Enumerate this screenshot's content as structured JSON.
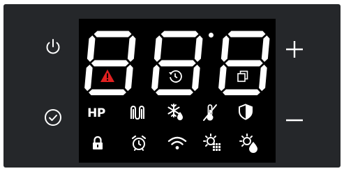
{
  "panel": {
    "power_icon": "power-icon",
    "ok_icon": "check-circle-icon",
    "plus_icon": "plus-icon",
    "minus_icon": "minus-icon"
  },
  "display": {
    "digits": [
      "8",
      "8",
      "8"
    ],
    "segment_color": "#ffffff",
    "alarm_color": "#e02020"
  },
  "icons_row1": {
    "hp_label": "HP",
    "heater_icon": "heater-icon",
    "defrost_icon": "defrost-icon",
    "temperature_off_icon": "temperature-off-icon",
    "shield_icon": "shield-icon"
  },
  "icons_row2": {
    "lock_icon": "lock-icon",
    "alarm_clock_icon": "alarm-clock-icon",
    "wifi_icon": "wifi-icon",
    "light_grid_icon": "light-grid-icon",
    "light_drop_icon": "light-drop-icon"
  }
}
